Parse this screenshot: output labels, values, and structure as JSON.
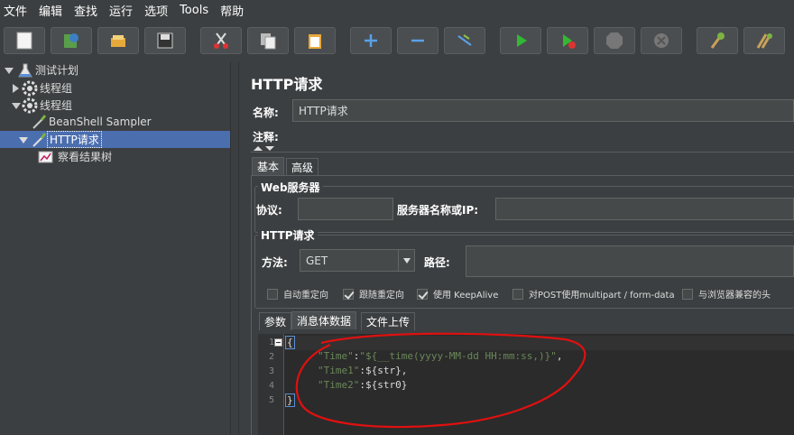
{
  "menu": [
    "文件",
    "编辑",
    "查找",
    "运行",
    "选项",
    "Tools",
    "帮助"
  ],
  "toolbar": {
    "buttons": [
      "new-icon",
      "templates-icon",
      "open-icon",
      "save-icon",
      "cut-icon",
      "copy-icon",
      "paste-icon",
      "expand-icon",
      "collapse-icon",
      "toggle-icon",
      "start-icon",
      "start-no-pause-icon",
      "stop-icon",
      "shutdown-icon",
      "clear-icon",
      "clear-all-icon"
    ]
  },
  "tree": {
    "items": [
      {
        "label": "测试计划"
      },
      {
        "label": "线程组"
      },
      {
        "label": "线程组"
      },
      {
        "label": "BeanShell Sampler"
      },
      {
        "label": "HTTP请求"
      },
      {
        "label": "察看结果树"
      }
    ]
  },
  "panel": {
    "title": "HTTP请求",
    "name_label": "名称:",
    "name_value": "HTTP请求",
    "comment_label": "注释:",
    "tabs": [
      "基本",
      "高级"
    ],
    "web_server": {
      "title": "Web服务器",
      "protocol_label": "协议:",
      "protocol_value": "",
      "server_label": "服务器名称或IP:",
      "server_value": ""
    },
    "http_request": {
      "title": "HTTP请求",
      "method_label": "方法:",
      "method_value": "GET",
      "path_label": "路径:",
      "path_value": ""
    },
    "checkboxes": [
      {
        "label": "自动重定向",
        "checked": false
      },
      {
        "label": "跟随重定向",
        "checked": true
      },
      {
        "label": "使用 KeepAlive",
        "checked": true
      },
      {
        "label": "对POST使用multipart / form-data",
        "checked": false
      },
      {
        "label": "与浏览器兼容的头",
        "checked": false
      }
    ],
    "body_tabs": [
      "参数",
      "消息体数据",
      "文件上传"
    ],
    "editor": {
      "line_numbers": [
        "1",
        "2",
        "3",
        "4",
        "5"
      ],
      "lines": [
        {
          "k": "\"Time\"",
          "sep": ":",
          "v": "\"${__time(yyyy-MM-dd HH:mm:ss,)}\"",
          "end": ","
        },
        {
          "k": "\"Time1\"",
          "sep": ":",
          "v": "${str}",
          "end": ","
        },
        {
          "k": "\"Time2\"",
          "sep": ":",
          "v": "${str0}",
          "end": ""
        }
      ],
      "open_brace": "{",
      "close_brace": "}"
    }
  },
  "colors": {
    "annotation": "#e01010",
    "selection": "#4b6eaf",
    "string": "#6a8759"
  }
}
